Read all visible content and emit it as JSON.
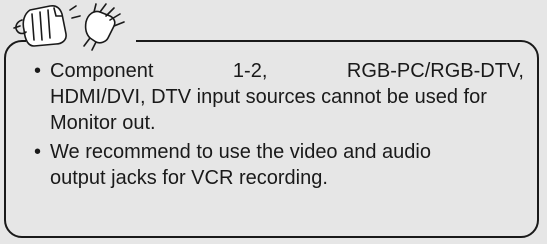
{
  "notes": {
    "bullet": "•",
    "items": [
      {
        "line1": "Component 1-2, RGB-PC/RGB-DTV,",
        "rest": "HDMI/DVI, DTV input sources cannot be used for Monitor out."
      },
      {
        "line1": "We recommend to use the video and audio",
        "rest": "output jacks for VCR recording."
      }
    ]
  }
}
